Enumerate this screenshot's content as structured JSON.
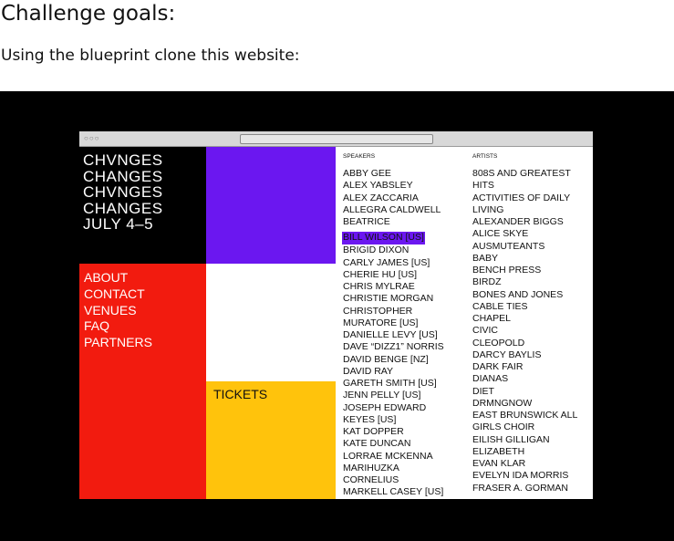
{
  "page": {
    "heading": "Challenge goals:",
    "intro": "Using the blueprint clone this website:"
  },
  "site": {
    "logo_lines": [
      "CHVNGES",
      "CHANGES",
      "CHVNGES",
      "CHANGES",
      "JULY  4–5"
    ],
    "nav": [
      "ABOUT",
      "CONTACT",
      "VENUES",
      "FAQ",
      "PARTNERS"
    ],
    "tickets": "TICKETS",
    "speakers_heading": "SPEAKERS",
    "speakers": [
      "ABBY GEE",
      "ALEX YABSLEY",
      "ALEX ZACCARIA",
      "ALLEGRA CALDWELL",
      "BEATRICE",
      "BILL WILSON [US]",
      "BRIGID DIXON",
      "CARLY JAMES [US]",
      "CHERIE HU [US]",
      "CHRIS MYLRAE",
      "CHRISTIE MORGAN",
      "CHRISTOPHER",
      "MURATORE [US]",
      "DANIELLE LEVY [US]",
      "DAVE “DIZZ1” NORRIS",
      "DAVID BENGE [NZ]",
      "DAVID RAY",
      "GARETH SMITH [US]",
      "JENN PELLY [US]",
      "JOSEPH EDWARD",
      "KEYES [US]",
      "KAT DOPPER",
      "KATE DUNCAN",
      "LORRAE MCKENNA",
      "MARIHUZKA",
      "CORNELIUS",
      "MARKELL CASEY [US]"
    ],
    "highlighted_speaker": "BILL WILSON [US]",
    "artists_heading": "ARTISTS",
    "artists": [
      "808S AND GREATEST",
      "HITS",
      "ACTIVITIES OF DAILY",
      "LIVING",
      "ALEXANDER BIGGS",
      "ALICE SKYE",
      "AUSMUTEANTS",
      "BABY",
      "BENCH PRESS",
      "BIRDZ",
      "BONES AND JONES",
      "CABLE TIES",
      "CHAPEL",
      "CIVIC",
      "CLEOPOLD",
      "DARCY BAYLIS",
      "DARK FAIR",
      "DIANAS",
      "DIET",
      "DRMNGNOW",
      "EAST BRUNSWICK ALL",
      "GIRLS CHOIR",
      "EILISH GILLIGAN",
      "ELIZABETH",
      "EVAN KLAR",
      "EVELYN IDA MORRIS",
      "FRASER A. GORMAN"
    ]
  },
  "colors": {
    "purple": "#6b17f0",
    "red": "#f21b0f",
    "yellow": "#ffc30c",
    "black": "#000000"
  }
}
